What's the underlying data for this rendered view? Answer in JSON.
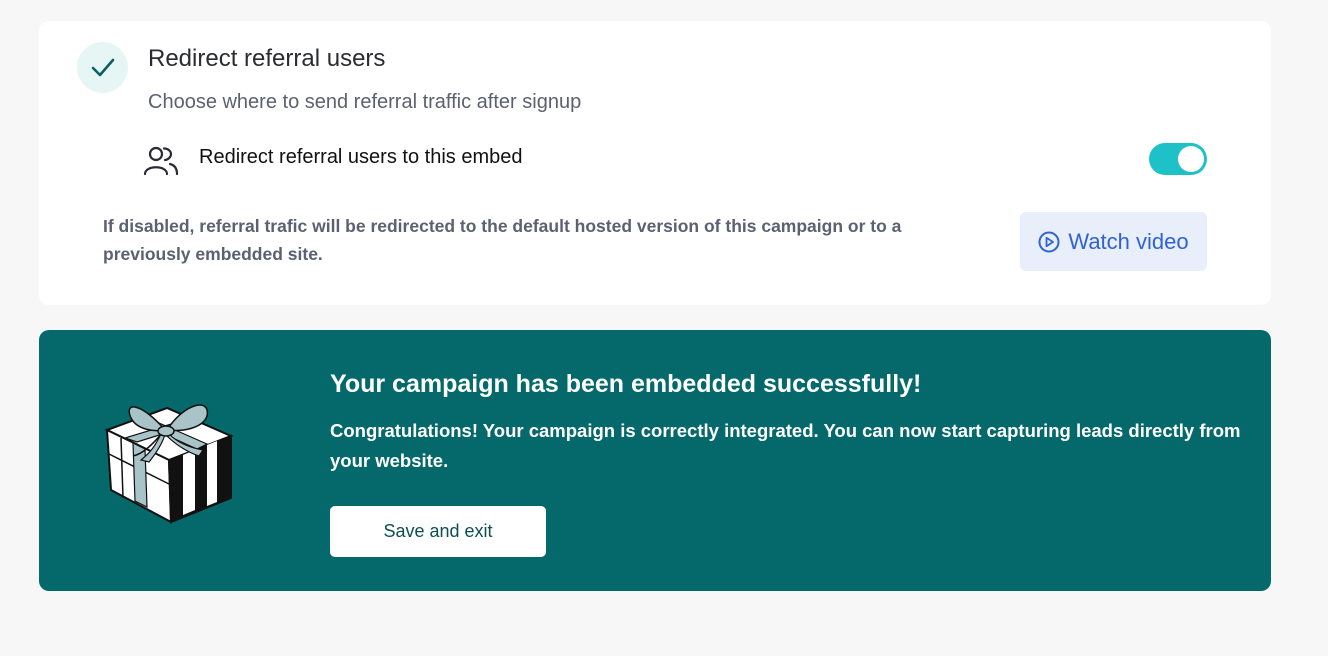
{
  "settings_card": {
    "title": "Redirect referral users",
    "subtitle": "Choose where to send referral traffic after signup",
    "option_label": "Redirect referral users to this embed",
    "toggle_on": true,
    "help_text": "If disabled, referral trafic will be redirected to the default hosted version of this campaign or to a previously embedded site.",
    "watch_video_label": "Watch video",
    "icons": {
      "status": "check-icon",
      "option": "users-icon",
      "watch": "play-circle-icon"
    }
  },
  "success_banner": {
    "title": "Your campaign has been embedded successfully!",
    "text": "Congratulations! Your campaign is correctly integrated. You can now start capturing leads directly from your website.",
    "save_label": "Save and exit",
    "illustration": "gift-box-illustration"
  },
  "colors": {
    "accent_teal": "#05696b",
    "toggle": "#1fc1c9",
    "link_blue": "#2f62d6"
  }
}
